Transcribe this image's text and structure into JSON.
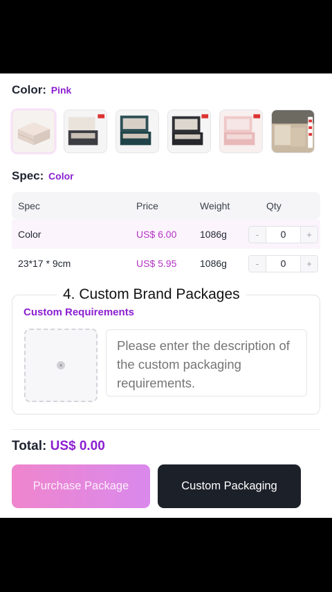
{
  "color": {
    "label": "Color:",
    "value": "Pink"
  },
  "thumbnails": [
    {
      "name": "cream-two-tier-box",
      "selected": true
    },
    {
      "name": "black-open-box"
    },
    {
      "name": "teal-open-box"
    },
    {
      "name": "dark-open-box"
    },
    {
      "name": "pink-open-box"
    },
    {
      "name": "packaging-photo"
    }
  ],
  "spec": {
    "label": "Spec:",
    "value": "Color"
  },
  "table": {
    "headers": {
      "spec": "Spec",
      "price": "Price",
      "weight": "Weight",
      "qty": "Qty"
    },
    "rows": [
      {
        "spec": "Color",
        "price": "US$ 6.00",
        "weight": "1086g",
        "minus": "-",
        "qty": "0",
        "plus": "+"
      },
      {
        "spec": "23*17 * 9cm",
        "price": "US$ 5.95",
        "weight": "1086g",
        "minus": "-",
        "qty": "0",
        "plus": "+"
      }
    ]
  },
  "custom": {
    "section_title": "4. Custom Brand Packages",
    "requirements_title": "Custom Requirements",
    "placeholder": "Please enter the description of the custom packaging requirements."
  },
  "total": {
    "label": "Total:",
    "amount": "US$ 0.00"
  },
  "buttons": {
    "purchase": "Purchase Package",
    "custom": "Custom Packaging"
  },
  "colors": {
    "accent_purple": "#8b1fd0",
    "price_pink": "#b333c4",
    "dark_button": "#1c2029"
  }
}
